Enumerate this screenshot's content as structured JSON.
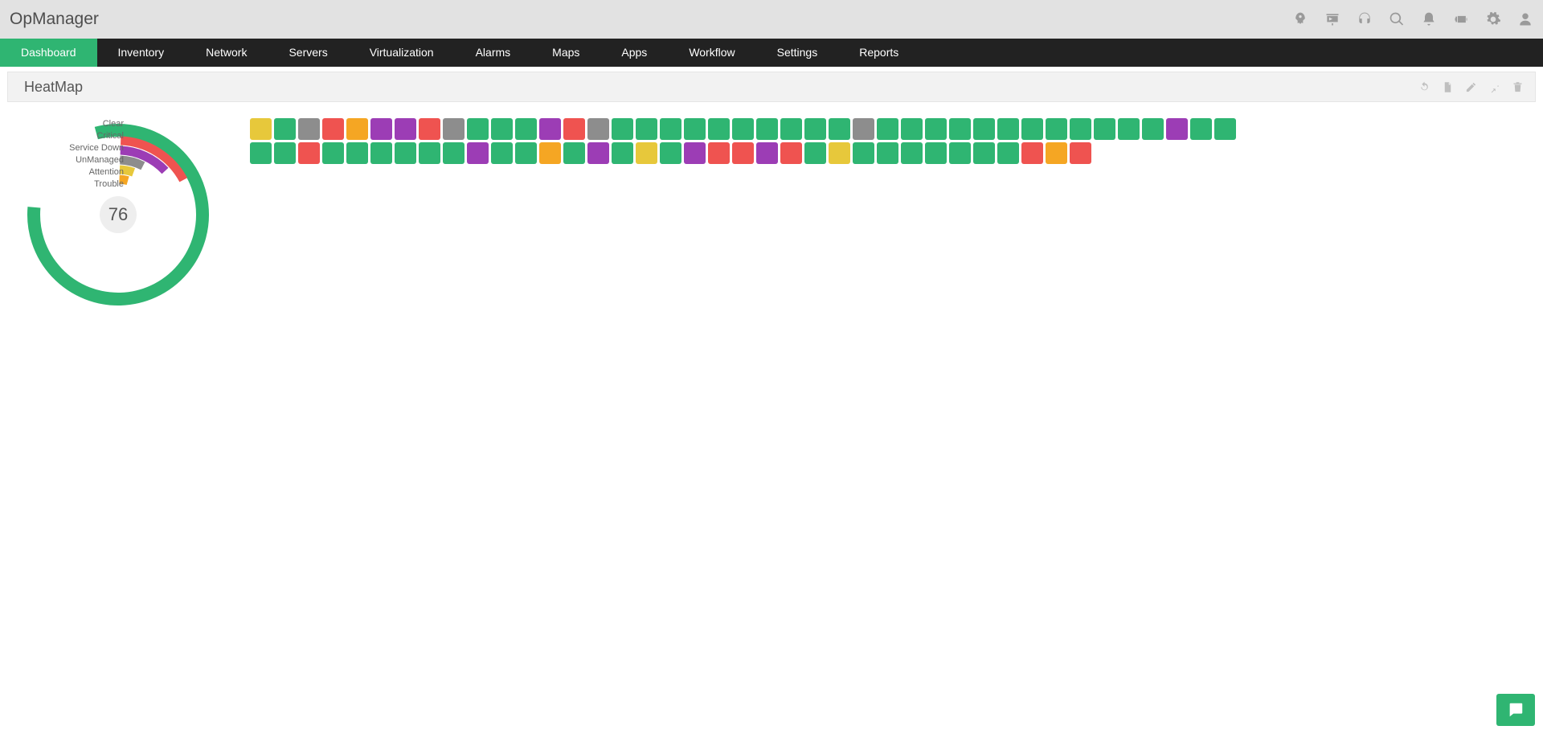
{
  "brand": "OpManager",
  "nav": [
    "Dashboard",
    "Inventory",
    "Network",
    "Servers",
    "Virtualization",
    "Alarms",
    "Maps",
    "Apps",
    "Workflow",
    "Settings",
    "Reports"
  ],
  "active_nav_index": 0,
  "panel": {
    "title": "HeatMap"
  },
  "colors": {
    "Clear": "#2fb572",
    "Critical": "#ef5350",
    "Service Down": "#9c3db5",
    "UnManaged": "#8d8d8d",
    "Attention": "#e7c83b",
    "Trouble": "#f5a623"
  },
  "chart_data": {
    "type": "pie",
    "gauge_total": 76,
    "legend_labels": [
      "Clear",
      "Critical",
      "Service Down",
      "UnManaged",
      "Attention",
      "Trouble"
    ],
    "series": [
      {
        "name": "Clear",
        "value": 47
      },
      {
        "name": "Critical",
        "value": 9
      },
      {
        "name": "Service Down",
        "value": 9
      },
      {
        "name": "UnManaged",
        "value": 5
      },
      {
        "name": "Attention",
        "value": 3
      },
      {
        "name": "Trouble",
        "value": 3
      }
    ],
    "heatmap_rows": [
      [
        "Attention",
        "Clear",
        "UnManaged",
        "Critical",
        "Trouble",
        "Service Down",
        "Service Down",
        "Critical",
        "UnManaged",
        "Clear",
        "Clear",
        "Clear",
        "Service Down",
        "Critical",
        "UnManaged",
        "Clear",
        "Clear",
        "Clear",
        "Clear",
        "Clear",
        "Clear",
        "Clear",
        "Clear",
        "Clear",
        "Clear",
        "UnManaged",
        "Clear",
        "Clear",
        "Clear",
        "Clear",
        "Clear",
        "Clear",
        "Clear",
        "Clear",
        "Clear",
        "Clear",
        "Clear",
        "Clear",
        "Service Down",
        "Clear",
        "Clear"
      ],
      [
        "Clear",
        "Clear",
        "Critical",
        "Clear",
        "Clear",
        "Clear",
        "Clear",
        "Clear",
        "Clear",
        "Service Down",
        "Clear",
        "Clear",
        "Trouble",
        "Clear",
        "Service Down",
        "Clear",
        "Attention",
        "Clear",
        "Service Down",
        "Critical",
        "Critical",
        "Service Down",
        "Critical",
        "Clear",
        "Attention",
        "Clear",
        "Clear",
        "Clear",
        "Clear",
        "Clear",
        "Clear",
        "Clear",
        "Critical",
        "Trouble",
        "Critical"
      ]
    ]
  }
}
